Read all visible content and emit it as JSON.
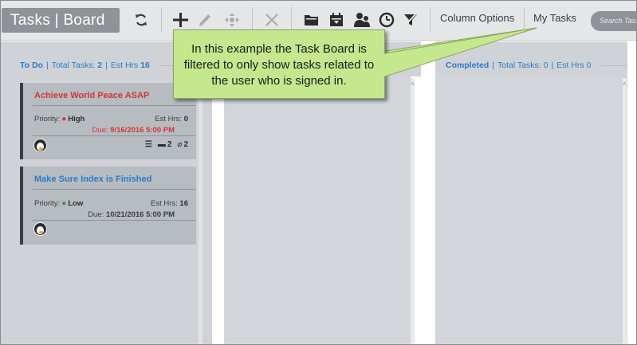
{
  "toolbar": {
    "title": "Tasks | Board",
    "buttons": [
      {
        "name": "refresh-button",
        "icon": "refresh-icon",
        "glyph": "⟳"
      },
      {
        "name": "add-task-button",
        "icon": "plus-icon",
        "glyph": "+"
      },
      {
        "name": "edit-task-button",
        "icon": "pencil-icon",
        "glyph": "✎"
      },
      {
        "name": "move-task-button",
        "icon": "move-icon",
        "glyph": "✥"
      },
      {
        "name": "delete-task-button",
        "icon": "close-icon",
        "glyph": "✕"
      }
    ],
    "column_options_label": "Column Options",
    "my_tasks_label": "My Tasks",
    "search_placeholder": "Search Tasks"
  },
  "columns": [
    {
      "name": "To Do",
      "total_tasks_label": "Total Tasks:",
      "total_tasks": "2",
      "est_hrs_label": "Est Hrs",
      "est_hrs": "16"
    },
    {
      "name": "Completed",
      "total_tasks_label": "Total Tasks:",
      "total_tasks": "0",
      "est_hrs_label": "Est Hrs",
      "est_hrs": "0"
    }
  ],
  "cards": [
    {
      "title": "Achieve World Peace ASAP",
      "title_color": "#d1343a",
      "priority_label": "Priority:",
      "priority": "High",
      "priority_color": "#d1343a",
      "est_hrs_label": "Est Hrs:",
      "est_hrs": "0",
      "due_label": "Due:",
      "due": "9/16/2016 5:00 PM",
      "due_color": "#d1343a",
      "comments": "2",
      "attachments": "2"
    },
    {
      "title": "Make Sure Index is Finished",
      "title_color": "#2b7bc4",
      "priority_label": "Priority:",
      "priority": "Low",
      "priority_color": "#2e9a3a",
      "est_hrs_label": "Est Hrs:",
      "est_hrs": "16",
      "due_label": "Due:",
      "due": "10/21/2016 5:00 PM",
      "due_color": "#3a3d42"
    }
  ],
  "callout": {
    "text": "In this example the Task Board is filtered to only show tasks related to the user who is signed in."
  }
}
